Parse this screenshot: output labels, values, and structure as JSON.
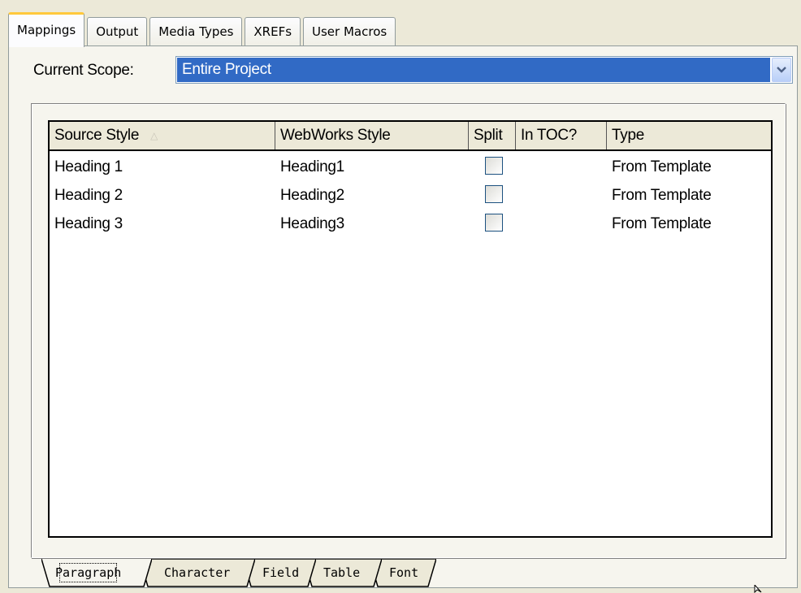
{
  "top_tabs": [
    {
      "label": "Mappings",
      "active": true
    },
    {
      "label": "Output",
      "active": false
    },
    {
      "label": "Media Types",
      "active": false
    },
    {
      "label": "XREFs",
      "active": false
    },
    {
      "label": "User Macros",
      "active": false
    }
  ],
  "scope": {
    "label": "Current Scope:",
    "value": "Entire Project",
    "dropdown_icon": "chevron-down-icon"
  },
  "table": {
    "columns": [
      "Source Style",
      "WebWorks Style",
      "Split",
      "In TOC?",
      "Type"
    ],
    "sort_icon": "sort-asc-icon",
    "rows": [
      {
        "source": "Heading 1",
        "webworks": "Heading1",
        "split": false,
        "in_toc": "",
        "type": "From Template"
      },
      {
        "source": "Heading 2",
        "webworks": "Heading2",
        "split": false,
        "in_toc": "",
        "type": "From Template"
      },
      {
        "source": "Heading 3",
        "webworks": "Heading3",
        "split": false,
        "in_toc": "",
        "type": "From Template"
      }
    ]
  },
  "bottom_tabs": [
    {
      "label": "Paragraph",
      "active": true
    },
    {
      "label": "Character",
      "active": false
    },
    {
      "label": "Field",
      "active": false
    },
    {
      "label": "Table",
      "active": false
    },
    {
      "label": "Font",
      "active": false
    }
  ],
  "colors": {
    "dialog_bg": "#ece9d8",
    "selection": "#316ac5",
    "active_tab_accent": "#ffc83c",
    "checkbox_border": "#1c5180"
  }
}
